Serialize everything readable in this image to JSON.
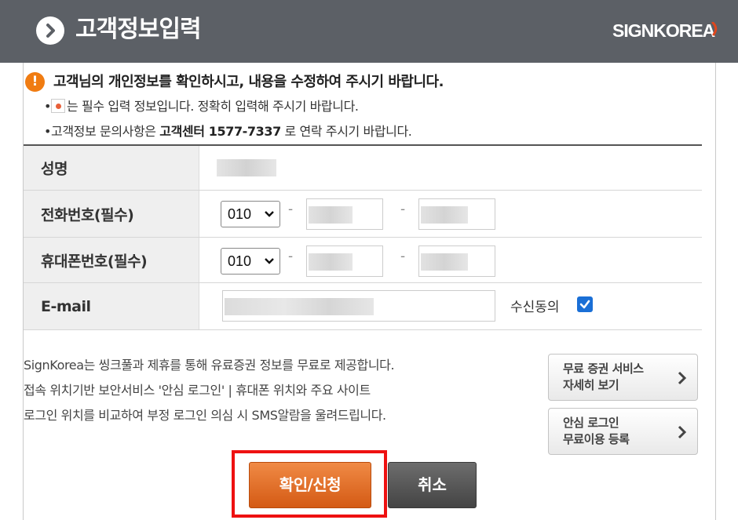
{
  "header": {
    "title": "고객정보입력",
    "logo_text": "SIGNKOREA",
    "bg_color": "#5c6066"
  },
  "notice": {
    "icon_symbol": "!",
    "main": "고객님의 개인정보를 확인하시고, 내용을 수정하여 주시기 바랍니다.",
    "sub1_bullet": "•",
    "sub1_text": "는 필수 입력 정보입니다. 정확히 입력해 주시기 바랍니다.",
    "sub2_prefix": "•고객정보 문의사항은 ",
    "sub2_bold": "고객센터 1577-7337",
    "sub2_suffix": " 로 연락 주시기 바랍니다."
  },
  "form": {
    "rows": [
      {
        "label": "성명"
      },
      {
        "label": "전화번호(필수)",
        "area_code": "010",
        "dash": "-"
      },
      {
        "label": "휴대폰번호(필수)",
        "area_code": "010",
        "dash": "-"
      },
      {
        "label": "E-mail",
        "consent_label": "수신동의",
        "consent_checked": true
      }
    ]
  },
  "info_text": {
    "line1": "SignKorea는 씽크풀과 제휴를 통해 유료증권 정보를 무료로 제공합니다.",
    "line2": "접속 위치기반 보안서비스 '안심 로그인' | 휴대폰 위치와 주요 사이트",
    "line3": "로그인 위치를 비교하여 부정 로그인 의심 시 SMS알람을 울려드립니다."
  },
  "side_buttons": [
    {
      "line1": "무료 증권 서비스",
      "line2": "자세히 보기"
    },
    {
      "line1": "안심 로그인",
      "line2": "무료이용 등록"
    }
  ],
  "actions": {
    "confirm_label": "확인/신청",
    "cancel_label": "취소",
    "confirm_color": "#e0671f",
    "cancel_color": "#555555",
    "highlight_color": "#ee1111"
  }
}
